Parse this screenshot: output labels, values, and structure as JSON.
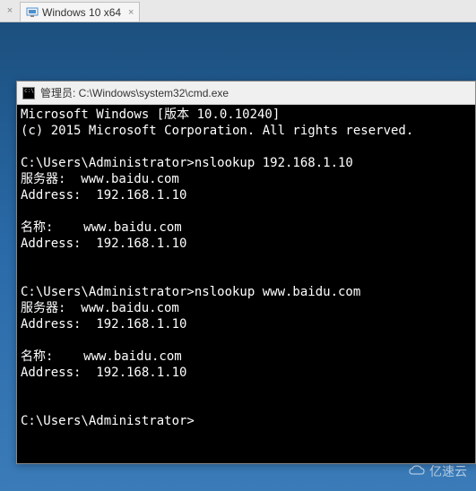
{
  "tab": {
    "label": "Windows 10 x64"
  },
  "cmd": {
    "title": "管理员: C:\\Windows\\system32\\cmd.exe",
    "lines": {
      "l0": "Microsoft Windows [版本 10.0.10240]",
      "l1": "(c) 2015 Microsoft Corporation. All rights reserved.",
      "l2": "",
      "l3": "C:\\Users\\Administrator>nslookup 192.168.1.10",
      "l4": "服务器:  www.baidu.com",
      "l5": "Address:  192.168.1.10",
      "l6": "",
      "l7": "名称:    www.baidu.com",
      "l8": "Address:  192.168.1.10",
      "l9": "",
      "l10": "",
      "l11": "C:\\Users\\Administrator>nslookup www.baidu.com",
      "l12": "服务器:  www.baidu.com",
      "l13": "Address:  192.168.1.10",
      "l14": "",
      "l15": "名称:    www.baidu.com",
      "l16": "Address:  192.168.1.10",
      "l17": "",
      "l18": "",
      "l19": "C:\\Users\\Administrator>"
    }
  },
  "watermark": {
    "text": "亿速云"
  }
}
